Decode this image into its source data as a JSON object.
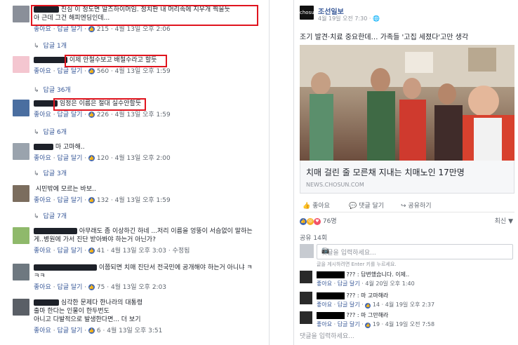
{
  "left": {
    "comments": [
      {
        "text": "진심 이 정도면 알즈하이머임. 정치판 내 머리속에 지우개 찍을듯",
        "text2": "아 근데 그건 해피엔딩인데...",
        "like": "좋아요",
        "reply": "답글 달기",
        "likes": "215",
        "date": "4월 13일 오후 2:06",
        "replies": "답글 1개"
      },
      {
        "text": "이제 안철수보고 배철수라고 할듯",
        "like": "좋아요",
        "reply": "답글 달기",
        "likes": "560",
        "date": "4월 13일 오후 1:59",
        "replies": "답글 36개"
      },
      {
        "text": "임정은 이름은 절대 실수안할듯",
        "like": "좋아요",
        "reply": "답글 달기",
        "likes": "226",
        "date": "4월 13일 오후 1:59",
        "replies": "답글 6개"
      },
      {
        "text": "마 고마해..",
        "like": "좋아요",
        "reply": "답글 달기",
        "likes": "120",
        "date": "4월 13일 오후 2:00",
        "replies": "답글 3개"
      },
      {
        "text": "시민밖에 모르는 바보..",
        "like": "좋아요",
        "reply": "답글 달기",
        "likes": "132",
        "date": "4월 13일 오후 1:59",
        "replies": "답글 7개"
      },
      {
        "text": "아무래도 좀 이상하긴 하네 ...저리 이름을 엉뚱이 서슴없이 말하는",
        "text2": "게..병원에 가서 진단 받아봐야 하는거 아닌가?",
        "like": "좋아요",
        "reply": "답글 달기",
        "likes": "41",
        "date": "4월 13일 오후 3:03",
        "edited": "수정됨"
      },
      {
        "text": "이쯤되면 치매 진단서 전국민에 공개해야 하는거 아니냐 ㅋ",
        "text2": "ㅋㅋ",
        "like": "좋아요",
        "reply": "답글 달기",
        "likes": "75",
        "date": "4월 13일 오후 2:03"
      },
      {
        "text": "심각한 문제다 한나라의 대통령",
        "text2": "출마 한다는 인물이 한두번도",
        "text3": "아니고 다발적으로 발생한다면... 더 보기",
        "like": "좋아요",
        "reply": "답글 달기",
        "likes": "6",
        "date": "4월 13일 오후 3:51"
      }
    ]
  },
  "right": {
    "page_name": "조선일보",
    "post_date": "4월 19일 오전 7:30 · ",
    "post_text": "조기 발견·치료 중요한데… 가족들 '고집 세졌다'고만 생각",
    "link_title": "치매 걸린 줄 모른채 지내는 치매노인 17만명",
    "link_domain": "NEWS.CHOSUN.COM",
    "actions": {
      "like": "좋아요",
      "comment": "댓글 달기",
      "share": "공유하기"
    },
    "reaction_count": "76명",
    "latest": "최신 ▼",
    "shares": "공유 14회",
    "comment_placeholder": "댓글을 입력하세요...",
    "enter_hint": "글을 게시하려면 Enter 키를 누르세요.",
    "comments": [
      {
        "text": "??? : 답변했습니다. 이제..",
        "like": "좋아요",
        "reply": "답글 달기",
        "date": "4월 20일 오후 1:40"
      },
      {
        "text": "??? : 마 고마해라",
        "like": "좋아요",
        "reply": "답글 달기",
        "likes": "14",
        "date": "4월 19일 오후 2:37"
      },
      {
        "text": "??? : 마 그만해라",
        "like": "좋아요",
        "reply": "답글 달기",
        "likes": "19",
        "date": "4월 19일 오전 7:58"
      }
    ],
    "bottom_placeholder": "댓글을 입력하세요..."
  }
}
